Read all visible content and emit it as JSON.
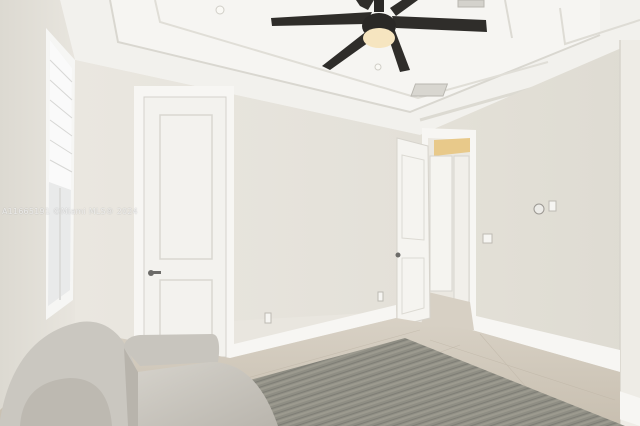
{
  "photo": {
    "watermark": "A11665191 ©Miami MLS® 2024"
  },
  "colors": {
    "wall": "#e7e4dc",
    "ceiling": "#f1f0ec",
    "floor": "#cfc6b8",
    "rug": "#8f8e84",
    "fan": "#2a2826",
    "sofa": "#c9c6bf",
    "trim": "#f7f6f3"
  }
}
